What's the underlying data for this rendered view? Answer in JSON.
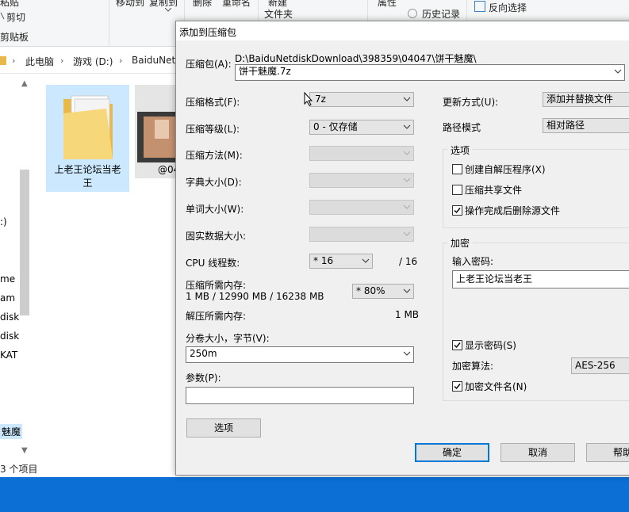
{
  "explorer": {
    "ribbon": {
      "paste_label": "粘贴",
      "cut_label": "剪切",
      "clipboard_label": "剪贴板",
      "move_to_label": "移动到",
      "copy_to_label": "复制到",
      "delete_label": "删除",
      "rename_label": "重命名",
      "new_label": "新建",
      "new_folder_label": "文件夹",
      "properties_label": "属性",
      "history_label": "历史记录",
      "invert_label": "反向选择"
    },
    "breadcrumb": [
      "此电脑",
      "游戏 (D:)",
      "BaiduNet"
    ],
    "nav_items": [
      ":)",
      "me",
      "am",
      "disk",
      "disk",
      "KAT",
      "魅魔"
    ],
    "files": [
      {
        "name_line1": "上老王论坛当老",
        "name_line2": "王"
      },
      {
        "name_line1": "@04"
      }
    ],
    "status": "3 个项目"
  },
  "dialog": {
    "title": "添加到压缩包",
    "archive_label": "压缩包(A):",
    "archive_path": "D:\\BaiduNetdiskDownload\\398359\\04047\\饼干魅魔\\",
    "archive_name": "饼干魅魔.7z",
    "format_label": "压缩格式(F):",
    "format_value": "7z",
    "level_label": "压缩等级(L):",
    "level_value": "0 - 仅存储",
    "method_label": "压缩方法(M):",
    "dict_label": "字典大小(D):",
    "word_label": "单词大小(W):",
    "solid_label": "固实数据大小:",
    "cpu_label": "CPU 线程数:",
    "cpu_value": "* 16",
    "cpu_total": "/ 16",
    "mem_comp_label": "压缩所需内存:",
    "mem_comp_value": "1 MB / 12990 MB / 16238 MB",
    "mem_percent": "* 80%",
    "mem_decomp_label": "解压所需内存:",
    "mem_decomp_value": "1 MB",
    "volume_label": "分卷大小，字节(V):",
    "volume_value": "250m",
    "params_label": "参数(P):",
    "params_value": "",
    "options_button": "选项",
    "update_label": "更新方式(U):",
    "update_value": "添加并替换文件",
    "path_label": "路径模式",
    "path_value": "相对路径",
    "options_group": "选项",
    "opt_sfx": "创建自解压程序(X)",
    "opt_sfx_checked": false,
    "opt_shared": "压缩共享文件",
    "opt_shared_checked": false,
    "opt_delete": "操作完成后删除源文件",
    "opt_delete_checked": true,
    "encrypt_group": "加密",
    "password_label": "输入密码:",
    "password_value": "上老王论坛当老王",
    "show_password": "显示密码(S)",
    "show_password_checked": true,
    "enc_method_label": "加密算法:",
    "enc_method_value": "AES-256",
    "encrypt_names": "加密文件名(N)",
    "encrypt_names_checked": true,
    "ok_button": "确定",
    "cancel_button": "取消",
    "help_button": "帮助"
  }
}
